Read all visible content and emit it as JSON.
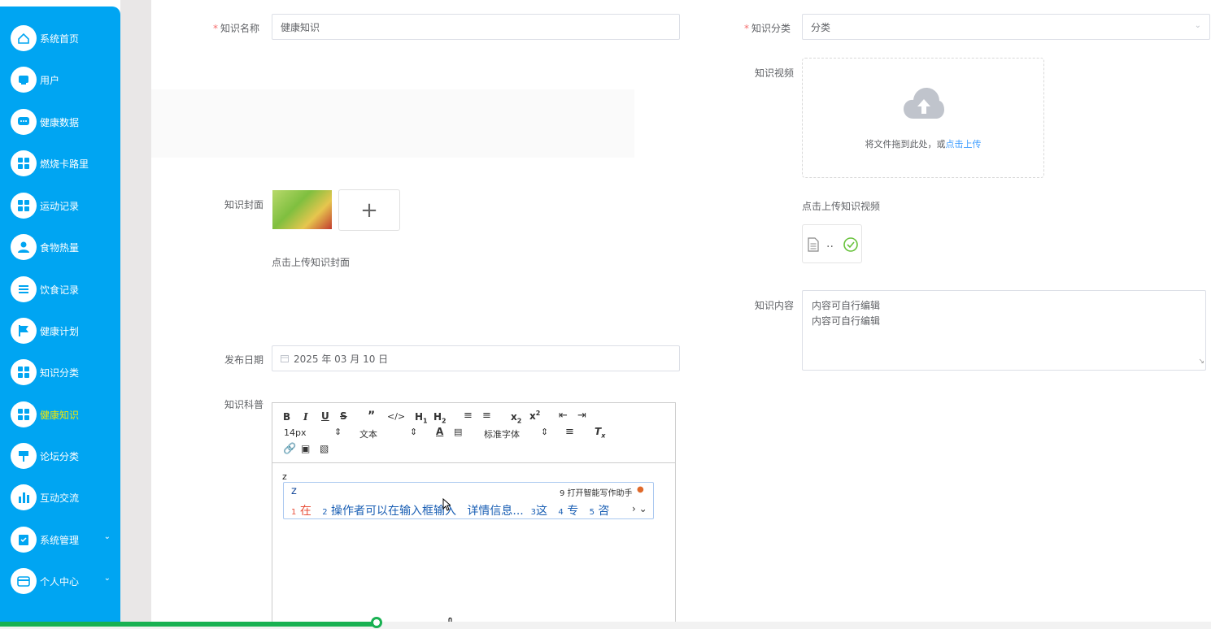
{
  "sidebar": {
    "items": [
      {
        "label": "系统首页",
        "icon": "home-icon"
      },
      {
        "label": "用户",
        "icon": "user-card-icon"
      },
      {
        "label": "健康数据",
        "icon": "chat-icon"
      },
      {
        "label": "燃烧卡路里",
        "icon": "grid-icon"
      },
      {
        "label": "运动记录",
        "icon": "grid-icon"
      },
      {
        "label": "食物热量",
        "icon": "person-icon"
      },
      {
        "label": "饮食记录",
        "icon": "list-icon"
      },
      {
        "label": "健康计划",
        "icon": "flag-icon"
      },
      {
        "label": "知识分类",
        "icon": "grid-icon"
      },
      {
        "label": "健康知识",
        "icon": "grid-icon"
      },
      {
        "label": "论坛分类",
        "icon": "signpost-icon"
      },
      {
        "label": "互动交流",
        "icon": "bar-chart-icon"
      },
      {
        "label": "系统管理",
        "icon": "clipboard-icon"
      },
      {
        "label": "个人中心",
        "icon": "wallet-icon"
      }
    ],
    "active_label": "健康知识"
  },
  "form": {
    "name_label": "知识名称",
    "name_value": "健康知识",
    "category_label": "知识分类",
    "category_value": "分类",
    "video_label": "知识视频",
    "video_drop_text": "将文件拖到此处，或",
    "video_drop_link": "点击上传",
    "video_hint": "点击上传知识视频",
    "video_file_name": "..",
    "cover_label": "知识封面",
    "cover_hint": "点击上传知识封面",
    "cover_add": "+",
    "content_label": "知识内容",
    "content_lines": [
      "内容可自行编辑",
      "内容可自行编辑"
    ],
    "date_label": "发布日期",
    "date_value": "2025 年 03 月 10 日",
    "science_label": "知识科普",
    "required_mark": "*"
  },
  "editor": {
    "font_size": "14px",
    "text_type": "文本",
    "font_family": "标准字体",
    "content": "z"
  },
  "ime": {
    "input": "z",
    "assist": "9 打开智能写作助手",
    "candidates": [
      {
        "num": "1",
        "text": "在"
      },
      {
        "num": "2",
        "text": "操作者可以在输入框输入"
      },
      {
        "num": "",
        "text": "详情信息..."
      },
      {
        "num": "3",
        "text": "这"
      },
      {
        "num": "4",
        "text": "专"
      },
      {
        "num": "5",
        "text": "咨"
      }
    ]
  },
  "progress": {
    "fraction": 0.31
  },
  "colors": {
    "sidebar": "#00a5f2",
    "active": "#f5e800",
    "link": "#409eff",
    "progress": "#19b152",
    "required": "#f56c6c"
  }
}
